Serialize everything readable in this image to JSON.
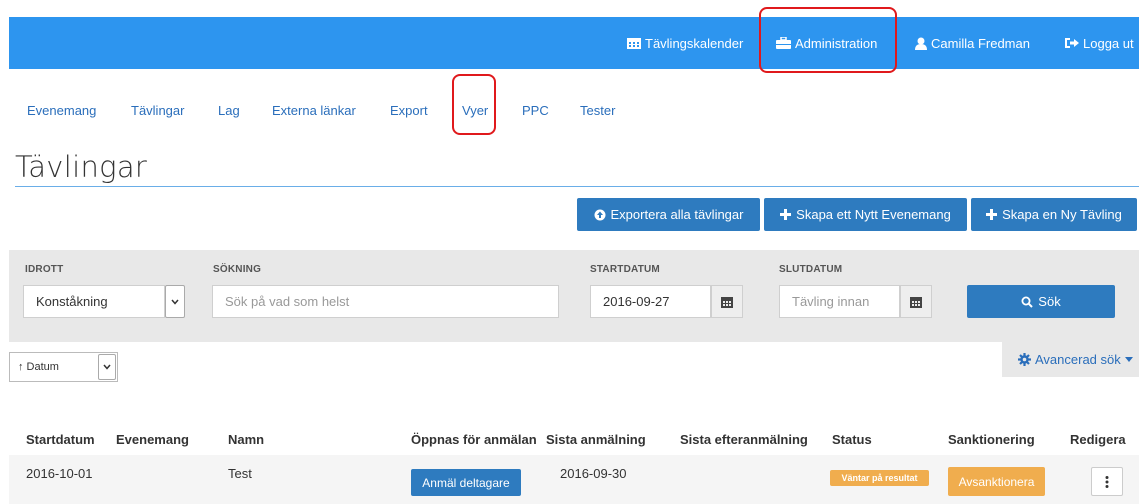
{
  "navbar": {
    "calendar": "Tävlingskalender",
    "administration": "Administration",
    "user": "Camilla Fredman",
    "logout": "Logga ut"
  },
  "subnav": [
    "Evenemang",
    "Tävlingar",
    "Lag",
    "Externa länkar",
    "Export",
    "Vyer",
    "PPC",
    "Tester"
  ],
  "page_title": "Tävlingar",
  "actions": {
    "export": "Exportera alla tävlingar",
    "new_event": "Skapa ett Nytt Evenemang",
    "new_competition": "Skapa en Ny Tävling"
  },
  "search": {
    "sport_label": "IDROTT",
    "sport_value": "Konståkning",
    "query_label": "SÖKNING",
    "query_placeholder": "Sök på vad som helst",
    "start_label": "STARTDATUM",
    "start_value": "2016-09-27",
    "end_label": "SLUTDATUM",
    "end_placeholder": "Tävling innan",
    "submit": "Sök"
  },
  "sort": {
    "value": "↑ Datum"
  },
  "advanced_search": "Avancerad sök",
  "table": {
    "headers": [
      "Startdatum",
      "Evenemang",
      "Namn",
      "Öppnas för anmälan",
      "Sista anmälning",
      "Sista efteranmälning",
      "Status",
      "Sanktionering",
      "Redigera"
    ],
    "rows": [
      {
        "startdatum": "2016-10-01",
        "evenemang": "",
        "namn": "Test",
        "oppnas_button": "Anmäl deltagare",
        "sista_anmalning": "2016-09-30",
        "sista_efteranmalning": "",
        "status": "Väntar på resultat",
        "sanktionering_button": "Avsanktionera"
      }
    ]
  },
  "colors": {
    "navbar": "#2d95ef",
    "primary_button": "#2e7bbf",
    "highlight": "#e0191c",
    "warning": "#f0ad4e",
    "link": "#2a6ebb"
  }
}
